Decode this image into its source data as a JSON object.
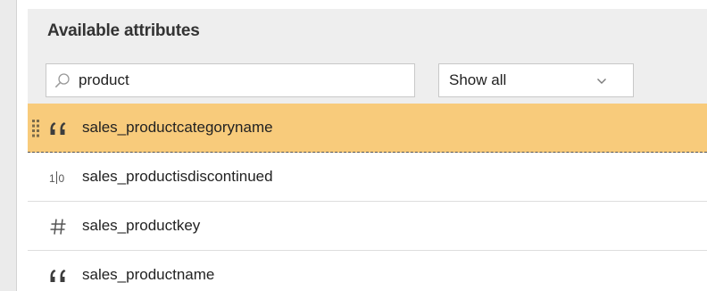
{
  "panel": {
    "title": "Available attributes"
  },
  "search": {
    "value": "product",
    "icon": "search-icon"
  },
  "filter": {
    "selected": "Show all",
    "icon": "chevron-down-icon"
  },
  "attributes": [
    {
      "label": "sales_productcategoryname",
      "type": "text",
      "icon": "text-quote-icon",
      "selected": true
    },
    {
      "label": "sales_productisdiscontinued",
      "type": "boolean",
      "icon": "boolean-icon",
      "selected": false
    },
    {
      "label": "sales_productkey",
      "type": "number",
      "icon": "hash-icon",
      "selected": false
    },
    {
      "label": "sales_productname",
      "type": "text",
      "icon": "text-quote-icon",
      "selected": false
    }
  ],
  "colors": {
    "selected_row": "#f8cb7b",
    "header_bg": "#eeeeee",
    "gutter": "#ebebeb"
  }
}
